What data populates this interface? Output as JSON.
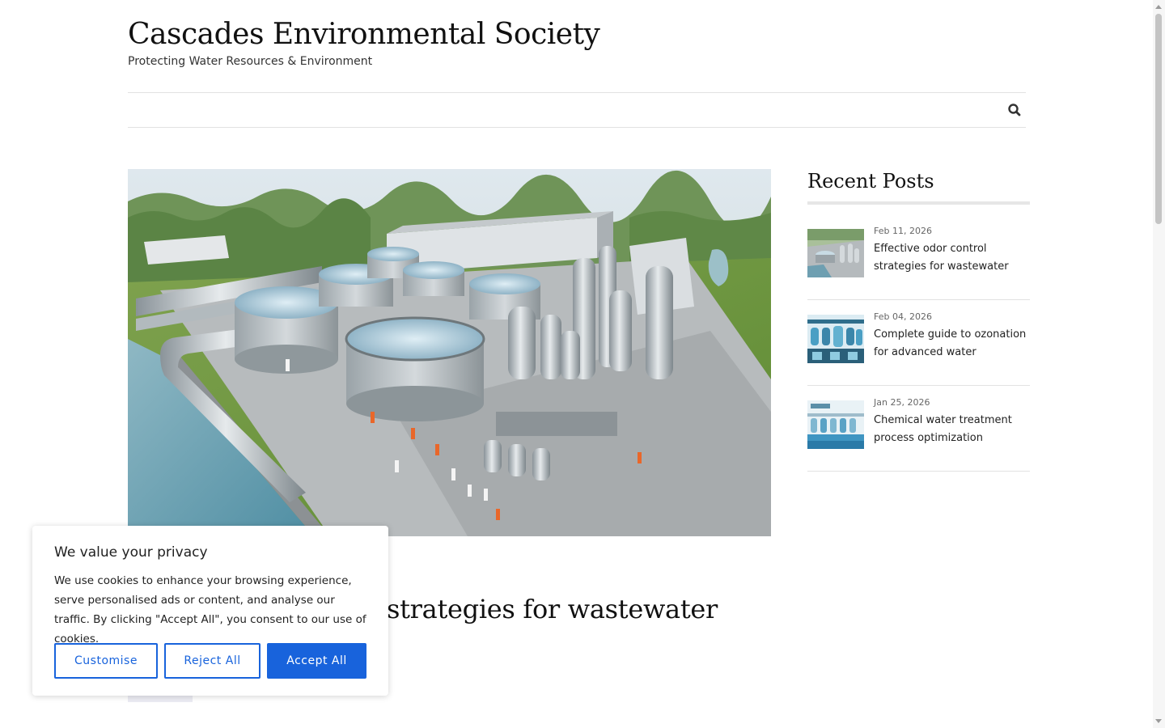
{
  "site": {
    "title": "Cascades Environmental Society",
    "tagline": "Protecting Water Resources & Environment"
  },
  "nav": {
    "search_icon": "search-icon"
  },
  "post": {
    "title_visible": "strategies for wastewater",
    "hero_image": "wastewater-treatment-plant-illustration"
  },
  "sidebar": {
    "heading": "Recent Posts",
    "posts": [
      {
        "date": "Feb 11, 2026",
        "title": "Effective odor control strategies for wastewater",
        "thumb": "treatment-plant-thumbnail"
      },
      {
        "date": "Feb 04, 2026",
        "title": "Complete guide to ozonation for advanced water",
        "thumb": "ozonation-diagram-thumbnail"
      },
      {
        "date": "Jan 25, 2026",
        "title": "Chemical water treatment process optimization",
        "thumb": "chemical-treatment-thumbnail"
      }
    ]
  },
  "cookie": {
    "title": "We value your privacy",
    "text": "We use cookies to enhance your browsing experience, serve personalised ads or content, and analyse our traffic. By clicking \"Accept All\", you consent to our use of cookies.",
    "customise_label": "Customise",
    "reject_label": "Reject All",
    "accept_label": "Accept All"
  },
  "colors": {
    "accent": "#1863dc",
    "divider": "#e2e2e2"
  }
}
